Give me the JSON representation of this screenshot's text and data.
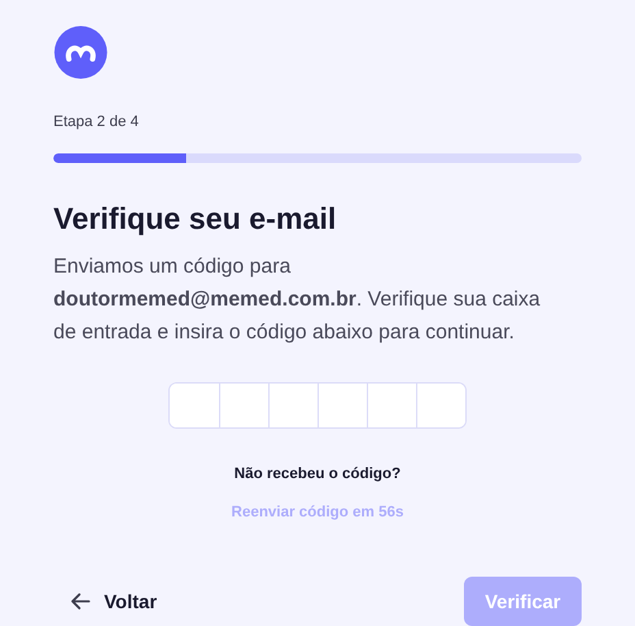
{
  "step": {
    "label": "Etapa 2 de 4",
    "level": 0.25
  },
  "title": "Verifique seu e-mail",
  "description": "Enviamos um código para **doutormemed@memed.com.br**. Verifique sua caixa de entrada e insira o código abaixo para continuar.",
  "resend": {
    "question": "Não recebeu o código?",
    "link": "Reenviar código em 56s",
    "disabled": true
  },
  "back_button": {
    "label": "Voltar"
  },
  "verify_button": {
    "label": "Verificar",
    "disabled": true
  }
}
